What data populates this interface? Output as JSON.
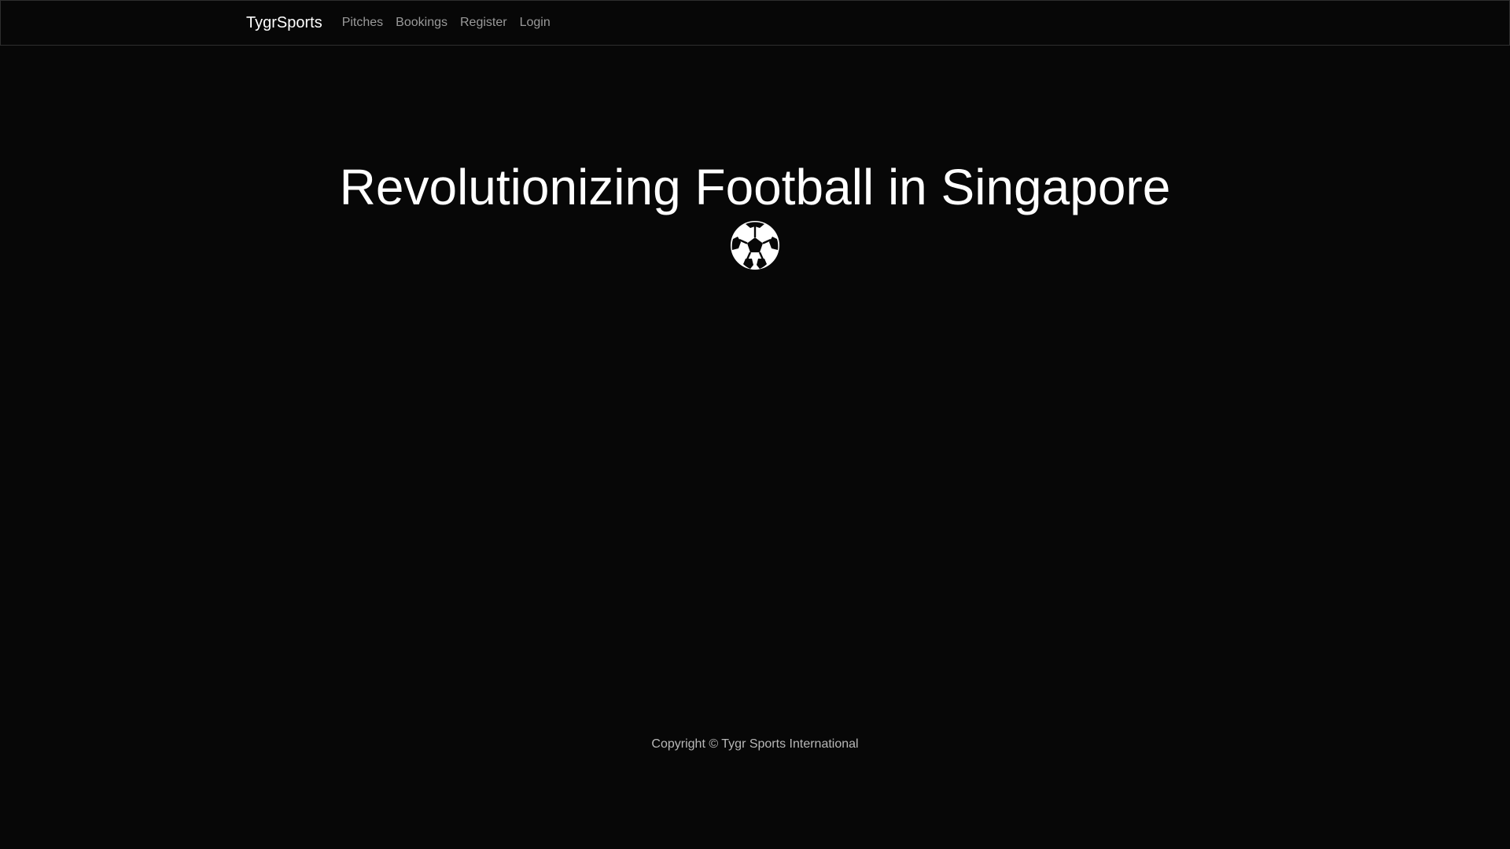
{
  "nav": {
    "brand": "TygrSports",
    "links": [
      "Pitches",
      "Bookings",
      "Register",
      "Login"
    ]
  },
  "hero": {
    "title": "Revolutionizing Football in Singapore",
    "icon": "soccer-ball-icon"
  },
  "footer": {
    "copyright": "Copyright © Tygr Sports International"
  },
  "colors": {
    "background": "#070707",
    "text_primary": "#ffffff",
    "nav_link": "#9a9a9a",
    "footer_text": "#b8b8b8",
    "nav_border": "#2e2e2e"
  }
}
